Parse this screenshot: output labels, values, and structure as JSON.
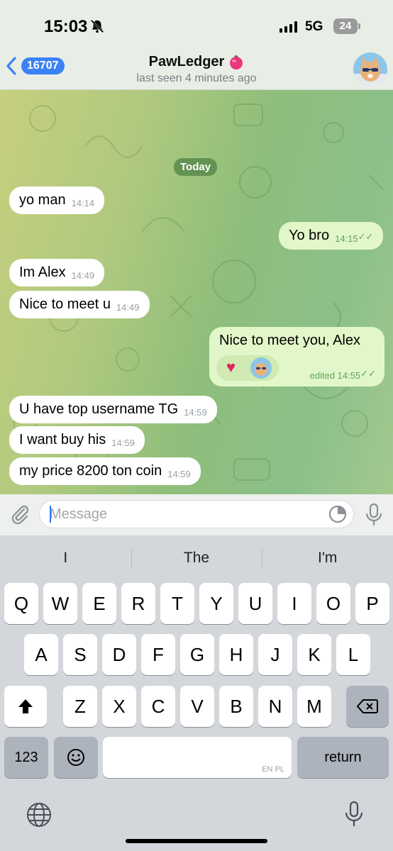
{
  "status_bar": {
    "time": "15:03",
    "network": "5G",
    "battery": "24"
  },
  "header": {
    "back_count": "16707",
    "title": "PawLedger",
    "subtitle": "last seen 4 minutes ago"
  },
  "chat": {
    "date_label": "Today",
    "messages": [
      {
        "direction": "in",
        "text": "yo man",
        "time": "14:14"
      },
      {
        "direction": "out",
        "text": "Yo bro",
        "time": "14:15",
        "read": true
      },
      {
        "direction": "in",
        "text": "Im Alex",
        "time": "14:49"
      },
      {
        "direction": "in",
        "text": "Nice to meet u",
        "time": "14:49"
      },
      {
        "direction": "out",
        "text": "Nice to meet you, Alex",
        "time": "edited 14:55",
        "read": true,
        "reaction": "red-heart"
      },
      {
        "direction": "in",
        "text": "U have top username TG",
        "time": "14:59"
      },
      {
        "direction": "in",
        "text": "I want buy his",
        "time": "14:59"
      },
      {
        "direction": "in",
        "text": "my price 8200 ton coin",
        "time": "14:59"
      }
    ]
  },
  "input": {
    "placeholder": "Message"
  },
  "keyboard": {
    "suggestions": [
      "I",
      "The",
      "I'm"
    ],
    "row1": [
      "Q",
      "W",
      "E",
      "R",
      "T",
      "Y",
      "U",
      "I",
      "O",
      "P"
    ],
    "row2": [
      "A",
      "S",
      "D",
      "F",
      "G",
      "H",
      "J",
      "K",
      "L"
    ],
    "row3": [
      "Z",
      "X",
      "C",
      "V",
      "B",
      "N",
      "M"
    ],
    "numbers_key": "123",
    "return_key": "return",
    "space_lang": "EN PL"
  },
  "colors": {
    "accent": "#3b82f6",
    "outgoing_bubble": "#e2f7c9",
    "incoming_bubble": "#ffffff",
    "read_ticks": "#5fa55a"
  }
}
